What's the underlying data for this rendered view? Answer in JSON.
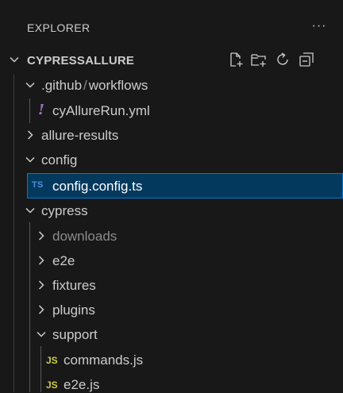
{
  "header": {
    "title": "EXPLORER",
    "more_label": "···"
  },
  "root": {
    "label": "CYPRESSALLURE"
  },
  "tree": {
    "github_part1": ".github",
    "github_sep": "/",
    "github_part2": "workflows",
    "yml_file": "cyAllureRun.yml",
    "yml_icon": "!",
    "allure_results": "allure-results",
    "config": "config",
    "config_ts": "config.config.ts",
    "ts_icon": "TS",
    "cypress": "cypress",
    "downloads": "downloads",
    "e2e": "e2e",
    "fixtures": "fixtures",
    "plugins": "plugins",
    "support": "support",
    "commands_js": "commands.js",
    "e2e_js": "e2e.js",
    "js_icon": "JS"
  },
  "colors": {
    "background": "#181818",
    "selection": "#04395e",
    "focus_border": "#0078d4",
    "yml_icon": "#a074c4",
    "ts_icon": "#4a90d9",
    "js_icon": "#cbcb41"
  }
}
